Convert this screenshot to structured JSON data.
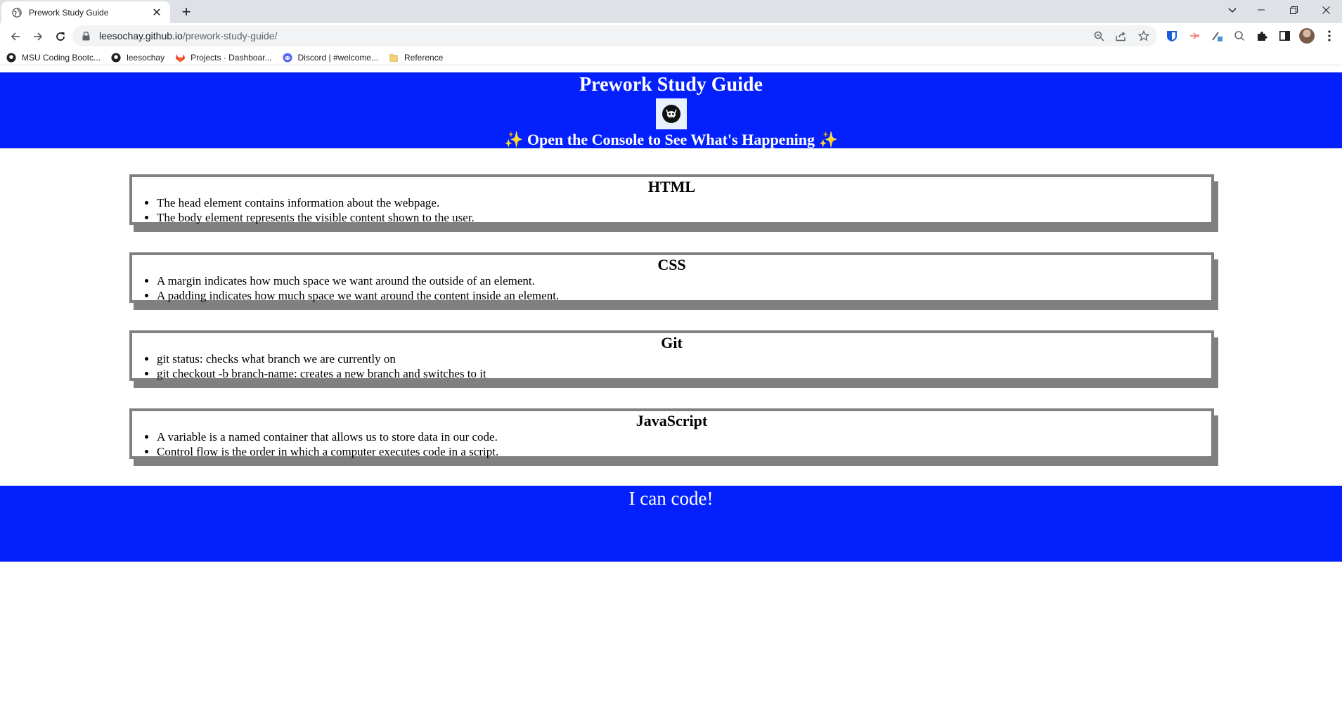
{
  "browser": {
    "tab_title": "Prework Study Guide",
    "url_host": "leesochay.github.io",
    "url_path": "/prework-study-guide/",
    "bookmarks": [
      {
        "label": "MSU Coding Bootc...",
        "icon": "github-icon"
      },
      {
        "label": "leesochay",
        "icon": "github-icon"
      },
      {
        "label": "Projects · Dashboar...",
        "icon": "gitlab-icon"
      },
      {
        "label": "Discord | #welcome...",
        "icon": "discord-icon"
      },
      {
        "label": "Reference",
        "icon": "folder-icon"
      }
    ]
  },
  "header": {
    "title": "Prework Study Guide",
    "subtitle": "✨ Open the Console to See What's Happening ✨",
    "background_color": "#0421fd"
  },
  "sections": [
    {
      "title": "HTML",
      "items": [
        "The head element contains information about the webpage.",
        "The body element represents the visible content shown to the user."
      ]
    },
    {
      "title": "CSS",
      "items": [
        "A margin indicates how much space we want around the outside of an element.",
        "A padding indicates how much space we want around the content inside an element."
      ]
    },
    {
      "title": "Git",
      "items": [
        "git status: checks what branch we are currently on",
        "git checkout -b branch-name: creates a new branch and switches to it"
      ]
    },
    {
      "title": "JavaScript",
      "items": [
        "A variable is a named container that allows us to store data in our code.",
        "Control flow is the order in which a computer executes code in a script."
      ]
    }
  ],
  "footer": {
    "text": "I can code!"
  }
}
